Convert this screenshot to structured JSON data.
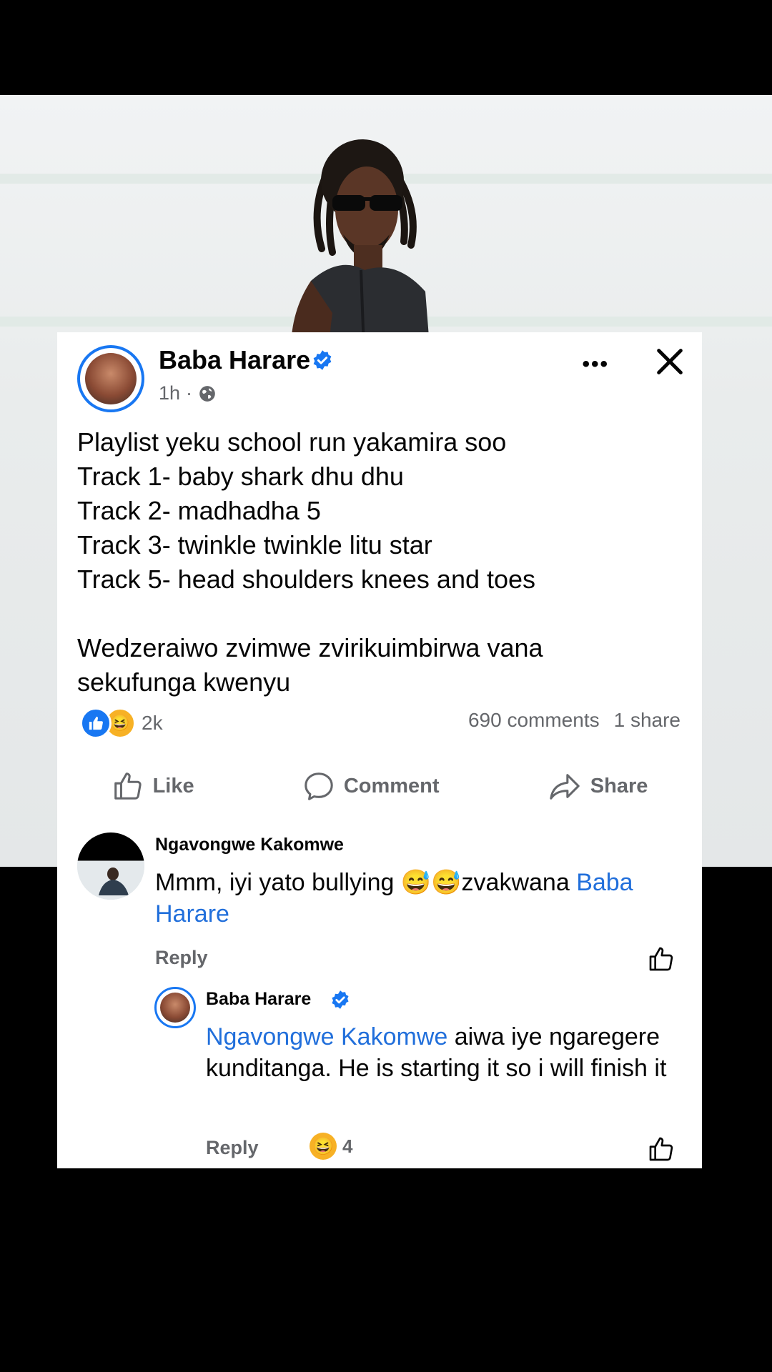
{
  "post": {
    "author": "Baba Harare",
    "time": "1h",
    "time_separator": "·",
    "text": "Playlist yeku school run yakamira soo\nTrack 1- baby shark dhu dhu\nTrack 2- madhadha 5\nTrack 3- twinkle twinkle litu star\nTrack 5- head shoulders knees and toes\n\nWedzeraiwo zvimwe zvirikuimbirwa vana\nsekufunga kwenyu",
    "reaction_count": "2k",
    "comments_count": "690 comments",
    "shares_count": "1 share",
    "actions": {
      "like": "Like",
      "comment": "Comment",
      "share": "Share"
    }
  },
  "comments": [
    {
      "author": "Ngavongwe Kakomwe",
      "text_before": "Mmm, iyi yato bullying 😅😅zvakwana ",
      "mention": "Baba Harare",
      "reply_label": "Reply"
    },
    {
      "author": "Baba Harare",
      "mention": "Ngavongwe Kakomwe",
      "text_after": " aiwa iye ngaregere kunditanga. He is starting it so i will finish it",
      "reply_label": "Reply",
      "reaction_count": "4"
    }
  ],
  "colors": {
    "accent": "#1877f2",
    "mention": "#216fdb",
    "muted": "#65676b",
    "haha": "#f7b125"
  }
}
